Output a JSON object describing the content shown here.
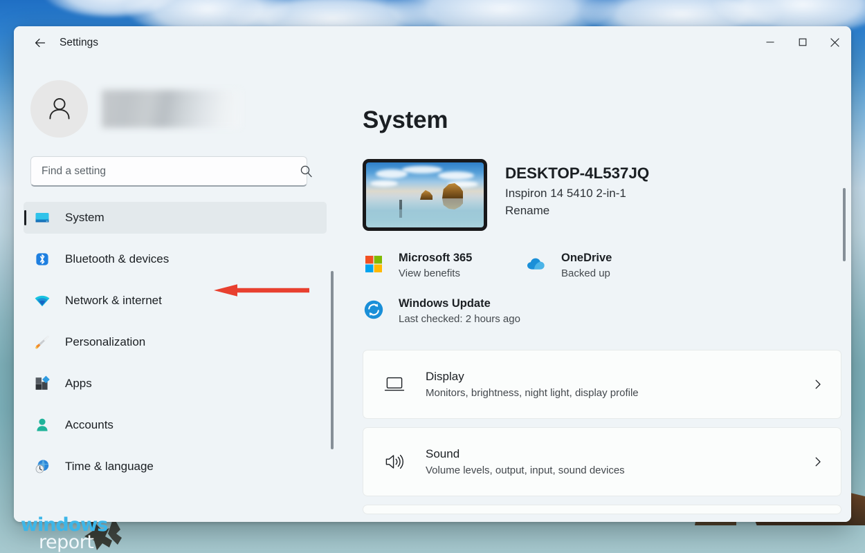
{
  "window": {
    "app_title": "Settings",
    "back_icon": "arrow-left-icon",
    "controls": {
      "minimize_label": "Minimize",
      "maximize_label": "Maximize",
      "close_label": "Close"
    }
  },
  "sidebar": {
    "account": {
      "avatar_icon": "person-icon",
      "name_redacted": ""
    },
    "search": {
      "placeholder": "Find a setting",
      "value": "",
      "icon": "search-icon"
    },
    "items": [
      {
        "label": "System",
        "icon": "monitor-icon",
        "selected": true
      },
      {
        "label": "Bluetooth & devices",
        "icon": "bluetooth-icon",
        "selected": false
      },
      {
        "label": "Network & internet",
        "icon": "wifi-icon",
        "selected": false
      },
      {
        "label": "Personalization",
        "icon": "paintbrush-icon",
        "selected": false
      },
      {
        "label": "Apps",
        "icon": "apps-icon",
        "selected": false
      },
      {
        "label": "Accounts",
        "icon": "person-icon",
        "selected": false
      },
      {
        "label": "Time & language",
        "icon": "clock-globe-icon",
        "selected": false
      }
    ]
  },
  "main": {
    "page_title": "System",
    "device": {
      "thumbnail_icon": "device-wallpaper-thumbnail",
      "name": "DESKTOP-4L537JQ",
      "model": "Inspiron 14 5410 2-in-1",
      "rename_label": "Rename"
    },
    "status_tiles": [
      {
        "title": "Microsoft 365",
        "subtitle": "View benefits",
        "icon": "microsoft-logo-icon"
      },
      {
        "title": "OneDrive",
        "subtitle": "Backed up",
        "icon": "onedrive-cloud-icon"
      },
      {
        "title": "Windows Update",
        "subtitle": "Last checked: 2 hours ago",
        "icon": "update-sync-icon"
      }
    ],
    "cards": [
      {
        "title": "Display",
        "subtitle": "Monitors, brightness, night light, display profile",
        "icon": "display-monitor-icon",
        "chevron": "chevron-right-icon"
      },
      {
        "title": "Sound",
        "subtitle": "Volume levels, output, input, sound devices",
        "icon": "speaker-icon",
        "chevron": "chevron-right-icon"
      }
    ]
  },
  "annotation": {
    "arrow_color": "#e8402f",
    "points_to": "Bluetooth & devices"
  },
  "watermark": {
    "line1": "windows",
    "line2": "report",
    "color_line1": "#3db6e8",
    "color_line2": "#f2f8fb"
  },
  "colors": {
    "window_background": "#eff4f7",
    "card_background": "#fbfdfc",
    "selected_nav_background": "#e3e9ec",
    "accent_text": "#1b1f23",
    "scrollbar": "#868f97"
  }
}
